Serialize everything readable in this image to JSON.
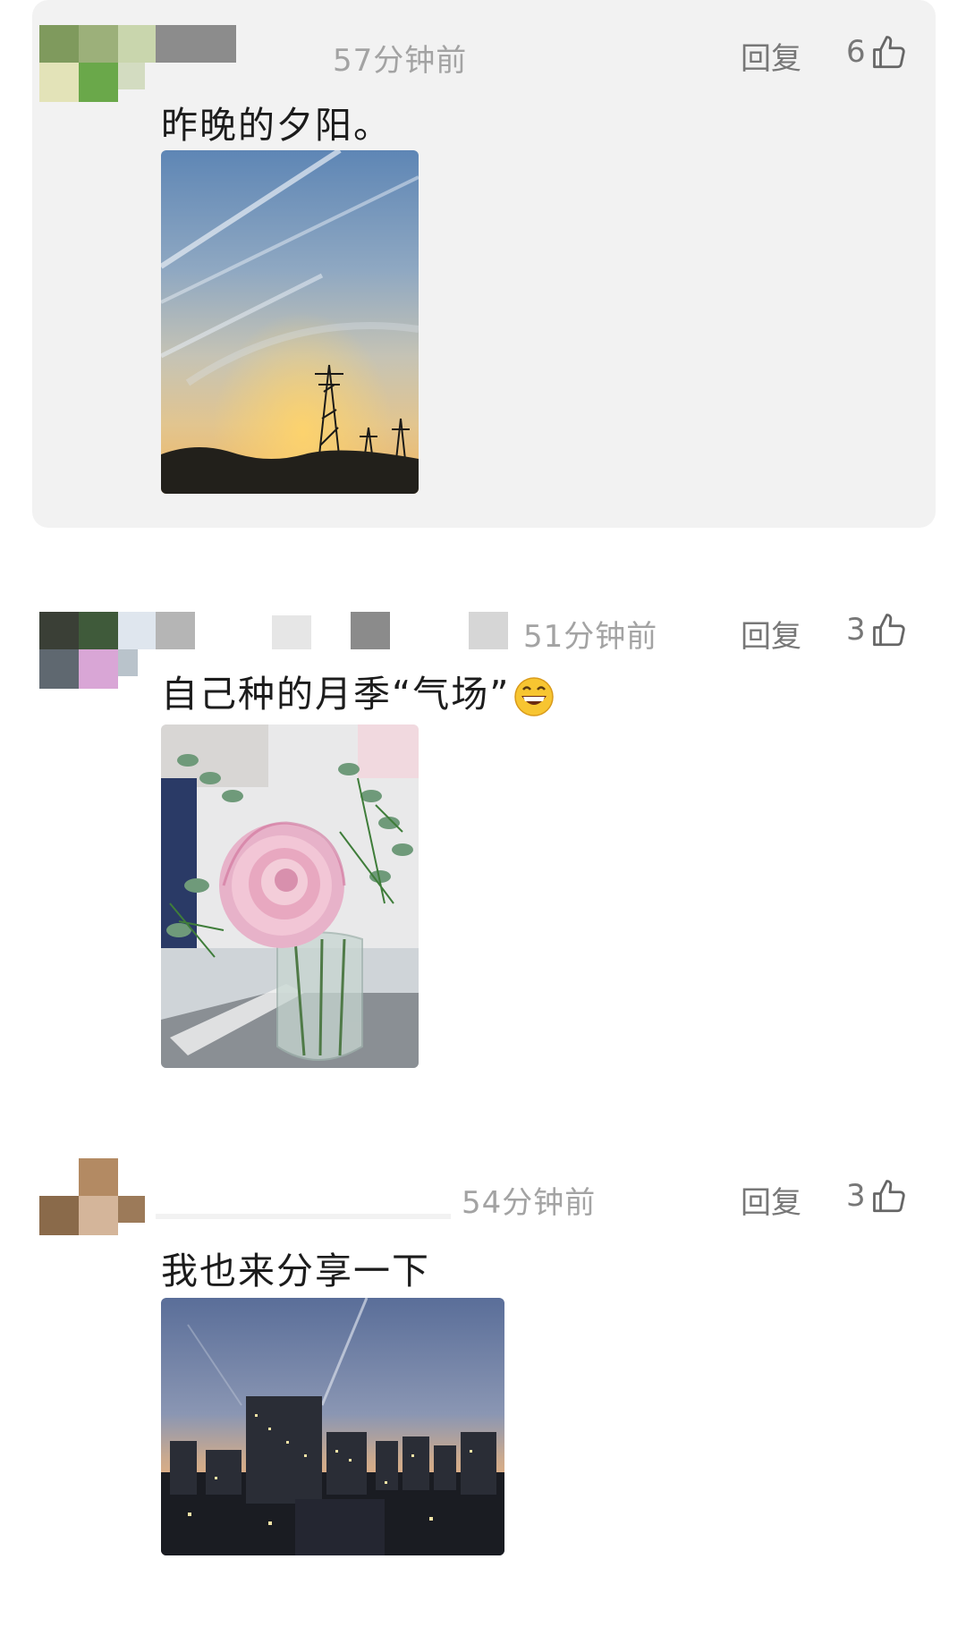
{
  "comments": [
    {
      "time": "57分钟前",
      "reply_label": "回复",
      "like_count": "6",
      "text": "昨晚的夕阳。",
      "photo_icon": "sunset-power-tower-photo"
    },
    {
      "time": "51分钟前",
      "reply_label": "回复",
      "like_count": "3",
      "text": "自己种的月季“气场”",
      "emoji_icon": "grinning-face-emoji",
      "photo_icon": "pink-rose-vase-photo"
    },
    {
      "time": "54分钟前",
      "reply_label": "回复",
      "like_count": "3",
      "text": "我也来分享一下",
      "photo_icon": "city-dusk-skyline-photo"
    }
  ],
  "colors": {
    "highlight_bg": "#f2f2f2",
    "meta_text": "#a3a3a3",
    "action_text": "#777777",
    "body_text": "#1c1c1c"
  },
  "icons": {
    "like": "thumbs-up-icon"
  }
}
